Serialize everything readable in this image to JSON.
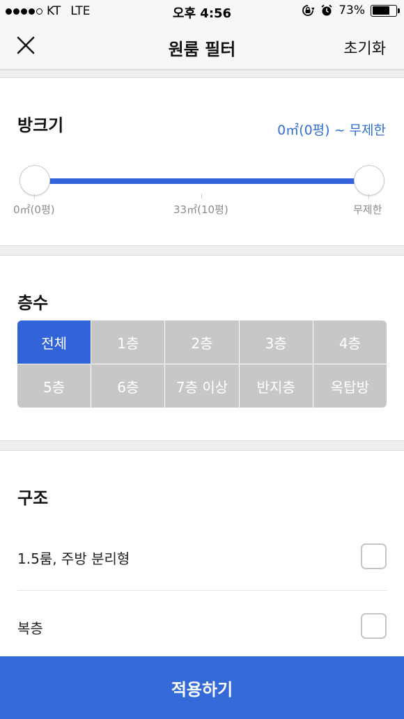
{
  "status_bar": {
    "carrier": "KT",
    "network": "LTE",
    "time": "오후 4:56",
    "battery": "73%",
    "battery_level": 0.73,
    "icons": [
      "signal-dots-icon",
      "rotation-lock-icon",
      "alarm-icon",
      "battery-icon"
    ]
  },
  "nav": {
    "title": "원룸 필터",
    "reset_label": "초기화",
    "close_icon": "close-icon"
  },
  "room_size": {
    "title": "방크기",
    "range_text": "0㎡(0평) ~ 무제한",
    "ticks": [
      "0㎡(0평)",
      "33㎡(10평)",
      "무제한"
    ],
    "min_value": 0,
    "max_value": 1
  },
  "floors": {
    "title": "층수",
    "options": [
      "전체",
      "1층",
      "2층",
      "3층",
      "4층",
      "5층",
      "6층",
      "7층 이상",
      "반지층",
      "옥탑방"
    ],
    "selected": "전체"
  },
  "structure": {
    "title": "구조",
    "options": [
      {
        "label": "1.5룸, 주방 분리형",
        "checked": false
      },
      {
        "label": "복층",
        "checked": false
      }
    ]
  },
  "apply_label": "적용하기",
  "colors": {
    "accent": "#3263d8",
    "link": "#2f6ed3",
    "inactive": "#c7c7c7",
    "nav_bg": "#f7f7f7"
  }
}
